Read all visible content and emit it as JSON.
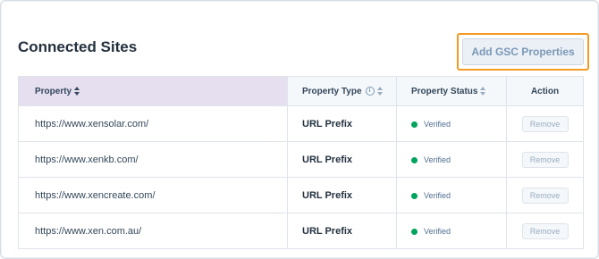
{
  "page": {
    "title": "Connected Sites",
    "add_button_label": "Add GSC Properties"
  },
  "table": {
    "headers": {
      "property": "Property",
      "property_type": "Property Type",
      "property_status": "Property Status",
      "action": "Action"
    },
    "rows": [
      {
        "property": "https://www.xensolar.com/",
        "type": "URL Prefix",
        "status": "Verified",
        "action": "Remove"
      },
      {
        "property": "https://www.xenkb.com/",
        "type": "URL Prefix",
        "status": "Verified",
        "action": "Remove"
      },
      {
        "property": "https://www.xencreate.com/",
        "type": "URL Prefix",
        "status": "Verified",
        "action": "Remove"
      },
      {
        "property": "https://www.xen.com.au/",
        "type": "URL Prefix",
        "status": "Verified",
        "action": "Remove"
      }
    ]
  },
  "icons": {
    "sort": "sort-icon",
    "info": "info-icon",
    "status": "status-dot-icon"
  },
  "colors": {
    "highlight_border": "#f59a23",
    "verified": "#00a35c",
    "sorted_header_bg": "#e6dff0"
  }
}
